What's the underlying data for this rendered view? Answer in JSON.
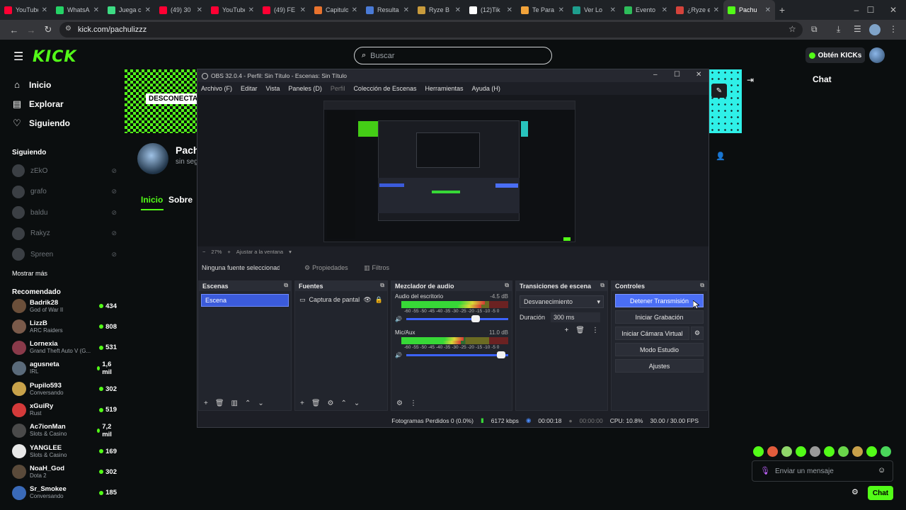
{
  "browser": {
    "tabs": [
      {
        "label": "YouTube",
        "color": "#ff0033",
        "active": false
      },
      {
        "label": "WhatsApp",
        "color": "#25d366",
        "active": false
      },
      {
        "label": "Juega c",
        "color": "#3ddc84",
        "active": false
      },
      {
        "label": "(49) 30",
        "color": "#ff0033",
        "active": false
      },
      {
        "label": "YouTube",
        "color": "#ff0033",
        "active": false
      },
      {
        "label": "(49) FE",
        "color": "#ff0033",
        "active": false
      },
      {
        "label": "Capitulo",
        "color": "#e8732e",
        "active": false
      },
      {
        "label": "Resulta",
        "color": "#4a7bd6",
        "active": false
      },
      {
        "label": "Ryze B",
        "color": "#c89b3c",
        "active": false
      },
      {
        "label": "(12)Tik",
        "color": "#ffffff",
        "active": false
      },
      {
        "label": "Te Para",
        "color": "#f2a33a",
        "active": false
      },
      {
        "label": "Ver Lo",
        "color": "#1e9e8e",
        "active": false
      },
      {
        "label": "Evento",
        "color": "#2dbd5a",
        "active": false
      },
      {
        "label": "¿Ryze e",
        "color": "#d4433b",
        "active": false
      },
      {
        "label": "Pachu",
        "color": "#53fc18",
        "active": true
      }
    ],
    "url": "kick.com/pachulizzz"
  },
  "kick": {
    "logo": "KICK",
    "search_placeholder": "Buscar",
    "kicks_button": "Obtén KICKs",
    "nav": {
      "home": "Inicio",
      "explore": "Explorar",
      "following": "Siguiendo"
    },
    "following_header": "Siguiendo",
    "following": [
      "zEkO",
      "grafo",
      "baldu",
      "Rakyz",
      "Spreen"
    ],
    "show_more": "Mostrar más",
    "recommended_header": "Recomendado",
    "recommended": [
      {
        "name": "Badrik28",
        "game": "God of War II",
        "viewers": "434",
        "color": "#6b4f3a"
      },
      {
        "name": "LizzB",
        "game": "ARC Raiders",
        "viewers": "808",
        "color": "#7a5a4a"
      },
      {
        "name": "Lornexia",
        "game": "Grand Theft Auto V (G...",
        "viewers": "531",
        "color": "#8a3a4a"
      },
      {
        "name": "agusneta",
        "game": "IRL",
        "viewers": "1,6 mil",
        "color": "#5a6a7a"
      },
      {
        "name": "Pupilo593",
        "game": "Conversando",
        "viewers": "302",
        "color": "#c8a24a"
      },
      {
        "name": "xGuiRy",
        "game": "Rust",
        "viewers": "519",
        "color": "#d43a3a"
      },
      {
        "name": "Ac7ionMan",
        "game": "Slots & Casino",
        "viewers": "7,2 mil",
        "color": "#4a4a4a"
      },
      {
        "name": "YANGLEE",
        "game": "Slots & Casino",
        "viewers": "169",
        "color": "#e8e8e8"
      },
      {
        "name": "NoaH_God",
        "game": "Dota 2",
        "viewers": "302",
        "color": "#5a4a3a"
      },
      {
        "name": "Sr_Smokee",
        "game": "Conversando",
        "viewers": "185",
        "color": "#3a6ab8"
      }
    ],
    "banner_text": "DESCONECTADO",
    "channel_name": "Pachulizzz",
    "channel_sub": "sin seguidores",
    "channel_tabs": {
      "home": "Inicio",
      "about": "Sobre"
    },
    "chat_title": "Chat",
    "chat_placeholder": "Enviar un mensaje",
    "chat_send": "Chat"
  },
  "obs": {
    "title": "OBS 32.0.4 - Perfil: Sin Título - Escenas: Sin Título",
    "menu": [
      "Archivo (F)",
      "Editar",
      "Vista",
      "Paneles (D)",
      "Perfil",
      "Colección de Escenas",
      "Herramientas",
      "Ayuda (H)"
    ],
    "zoom": "27%",
    "fit": "Ajustar a la ventana",
    "no_source": "Ninguna fuente seleccionada",
    "properties": "Propiedades",
    "filters": "Filtros",
    "docks": {
      "scenes": "Escenas",
      "sources": "Fuentes",
      "mixer": "Mezclador de audio",
      "transitions": "Transiciones de escena",
      "controls": "Controles"
    },
    "scene_item": "Escena",
    "source_item": "Captura de pantalla",
    "mixer": [
      {
        "name": "Audio del escritorio",
        "db": "-4.5 dB",
        "level": 0.78,
        "fader": 0.72
      },
      {
        "name": "Mic/Aux",
        "db": "11.0 dB",
        "level": 0.58,
        "fader": 0.97
      }
    ],
    "meter_scale": "-60 -55 -50 -45 -40 -35 -30 -25 -20 -15 -10 -5 0",
    "transition": "Desvanecimiento",
    "duration_label": "Duración",
    "duration_value": "300 ms",
    "controls": [
      "Detener Transmisión",
      "Iniciar Grabación",
      "Iniciar Cámara Virtual",
      "Modo Estudio",
      "Ajustes"
    ],
    "status": {
      "dropped": "Fotogramas Perdidos 0 (0.0%)",
      "bitrate": "6172 kbps",
      "stream_time": "00:00:18",
      "rec_time": "00:00:00",
      "cpu": "CPU: 10.8%",
      "fps": "30.00 / 30.00 FPS"
    }
  }
}
